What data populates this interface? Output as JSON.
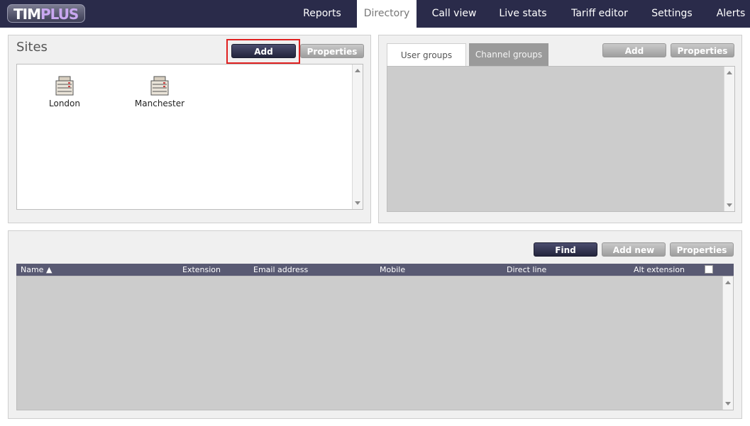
{
  "logo": {
    "part1": "TIM",
    "part2": "PLUS"
  },
  "nav": {
    "items": [
      {
        "label": "Reports"
      },
      {
        "label": "Directory"
      },
      {
        "label": "Call view"
      },
      {
        "label": "Live stats"
      },
      {
        "label": "Tariff editor"
      },
      {
        "label": "Settings"
      },
      {
        "label": "Alerts"
      }
    ],
    "active": "Directory"
  },
  "sites": {
    "title": "Sites",
    "add_label": "Add",
    "properties_label": "Properties",
    "items": [
      {
        "label": "London",
        "icon": "server-icon"
      },
      {
        "label": "Manchester",
        "icon": "server-icon"
      }
    ]
  },
  "groups": {
    "tabs": [
      {
        "label": "User groups"
      },
      {
        "label": "Channel groups"
      }
    ],
    "active_tab": "User groups",
    "add_label": "Add",
    "properties_label": "Properties"
  },
  "users": {
    "find_label": "Find",
    "add_new_label": "Add new",
    "properties_label": "Properties",
    "columns": [
      "Name ▲",
      "Extension",
      "Email address",
      "Mobile",
      "Direct line",
      "Alt extension"
    ],
    "rows": []
  },
  "colors": {
    "nav_bg": "#2a2b4a",
    "header_bg": "#595a73",
    "highlight": "#e02020",
    "empty_area": "#cccccc"
  }
}
